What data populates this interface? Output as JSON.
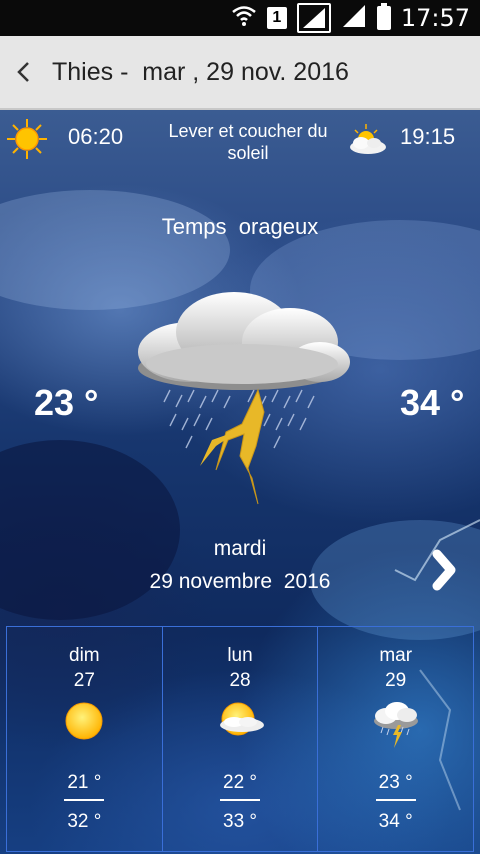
{
  "status_bar": {
    "time": "17:57",
    "sim_label": "1"
  },
  "app_bar": {
    "title": "Thies -  mar , 29 nov. 2016"
  },
  "sun": {
    "sunrise": "06:20",
    "label": "Lever et coucher du soleil",
    "sunset": "19:15"
  },
  "today": {
    "condition": "Temps  orageux",
    "temp_min": "23 °",
    "temp_max": "34 °",
    "day_name": "mardi",
    "full_date": "29 novembre  2016",
    "icon": "thunderstorm-icon"
  },
  "forecast": [
    {
      "day": "dim",
      "date": "27",
      "min": "21 °",
      "max": "32 °",
      "icon": "sun-icon"
    },
    {
      "day": "lun",
      "date": "28",
      "min": "22 °",
      "max": "33 °",
      "icon": "sun-cloud-icon"
    },
    {
      "day": "mar",
      "date": "29",
      "min": "23 °",
      "max": "34 °",
      "icon": "thunderstorm-icon"
    }
  ],
  "colors": {
    "app_bar_bg": "#e6e6e6",
    "forecast_border": "#3a6fd8",
    "sun": "#ffc400",
    "bolt": "#e8b828"
  }
}
